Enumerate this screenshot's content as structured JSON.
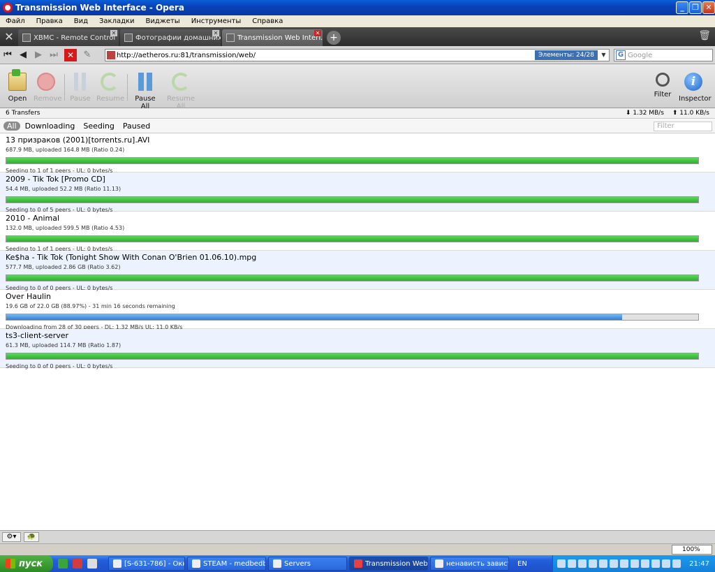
{
  "window": {
    "title": "Transmission Web Interface - Opera"
  },
  "menu": [
    "Файл",
    "Правка",
    "Вид",
    "Закладки",
    "Виджеты",
    "Инструменты",
    "Справка"
  ],
  "tabs": [
    {
      "label": "XBMC - Remote Control"
    },
    {
      "label": "Фотографии домашних..."
    },
    {
      "label": "Transmission Web Interf..."
    }
  ],
  "address": {
    "url": "http://aetheros.ru:81/transmission/web/",
    "badge": "Элементы: 24/28",
    "search_placeholder": "Google"
  },
  "toolbar": {
    "open": "Open",
    "remove": "Remove",
    "pause": "Pause",
    "resume": "Resume",
    "pause_all": "Pause All",
    "resume_all": "Resume All",
    "filter": "Filter",
    "inspector": "Inspector"
  },
  "stats": {
    "transfers": "6 Transfers",
    "download_speed": "⬇ 1.32 MB/s",
    "upload_speed": "⬆ 11.0 KB/s"
  },
  "filters": {
    "all": "All",
    "downloading": "Downloading",
    "seeding": "Seeding",
    "paused": "Paused",
    "search_placeholder": "Filter"
  },
  "torrents": [
    {
      "name": "13 призраков (2001)[torrents.ru].AVI",
      "info": "687.9 MB, uploaded 164.8 MB (Ratio 0.24)",
      "progress": 1.0,
      "status": "Seeding to 1 of 1 peers - UL: 0 bytes/s",
      "state": "seeding"
    },
    {
      "name": "2009 - Tik Tok [Promo CD]",
      "info": "54.4 MB, uploaded 52.2 MB (Ratio 11.13)",
      "progress": 1.0,
      "status": "Seeding to 0 of 5 peers - UL: 0 bytes/s",
      "state": "seeding"
    },
    {
      "name": "2010 - Animal",
      "info": "132.0 MB, uploaded 599.5 MB (Ratio 4.53)",
      "progress": 1.0,
      "status": "Seeding to 1 of 1 peers - UL: 0 bytes/s",
      "state": "seeding"
    },
    {
      "name": "Ke$ha - Tik Tok (Tonight Show With Conan O'Brien 01.06.10).mpg",
      "info": "577.7 MB, uploaded 2.86 GB (Ratio 3.62)",
      "progress": 1.0,
      "status": "Seeding to 0 of 0 peers - UL: 0 bytes/s",
      "state": "seeding"
    },
    {
      "name": "Over Haulin",
      "info": "19.6 GB of 22.0 GB (88.97%) - 31 min 16 seconds remaining",
      "progress": 0.8897,
      "status": "Downloading from 28 of 30 peers - DL: 1.32 MB/s UL: 11.0 KB/s",
      "state": "downloading"
    },
    {
      "name": "ts3-client-server",
      "info": "61.3 MB, uploaded 114.7 MB (Ratio 1.87)",
      "progress": 1.0,
      "status": "Seeding to 0 of 0 peers - UL: 0 bytes/s",
      "state": "seeding"
    }
  ],
  "statusbar": {
    "zoom": "100%"
  },
  "taskbar": {
    "start": "пуск",
    "tasks": [
      {
        "label": "[S-631-786] - Окн..."
      },
      {
        "label": "STEAM - medbedb812"
      },
      {
        "label": "Servers"
      },
      {
        "label": "Transmission Web I..."
      },
      {
        "label": "ненависть завист..."
      }
    ],
    "lang": "EN",
    "clock": "21:47"
  }
}
